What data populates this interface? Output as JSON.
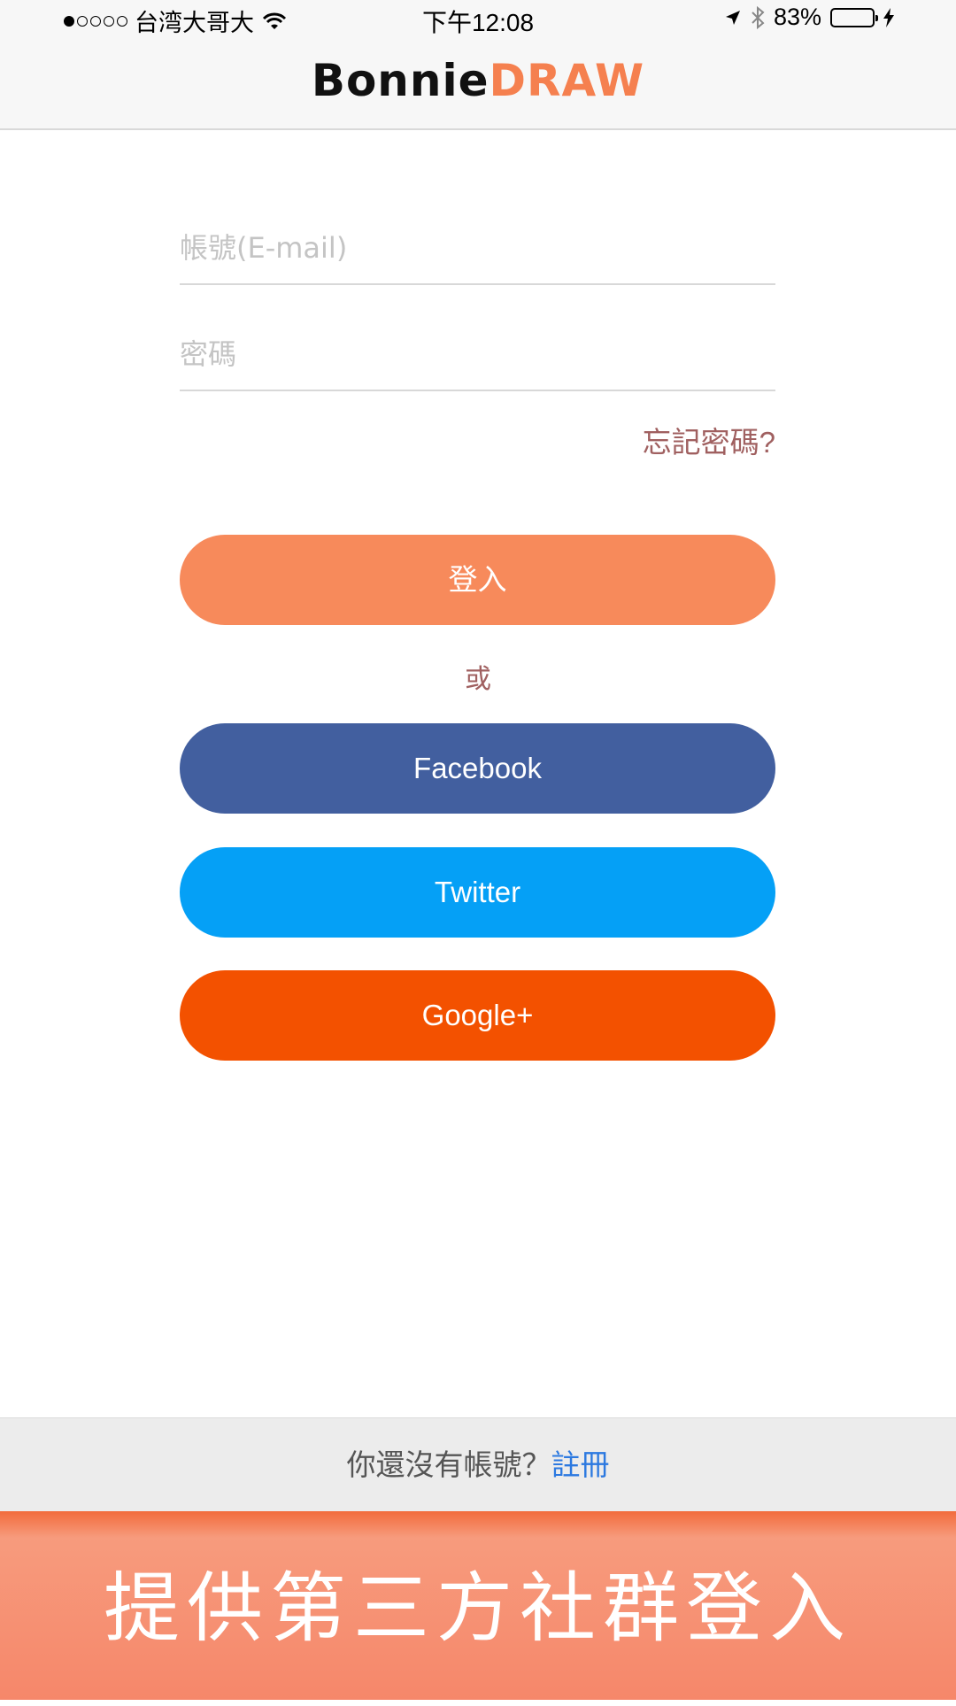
{
  "status_bar": {
    "carrier": "台湾大哥大",
    "time": "下午12:08",
    "battery": "83%",
    "battery_level": 0.83
  },
  "header": {
    "logo_part1": "Bonnie",
    "logo_part2": "DRAW",
    "colors": {
      "logo_dark": "#111111",
      "logo_accent": "#f5804f"
    }
  },
  "form": {
    "email_placeholder": "帳號(E-mail)",
    "email_value": "",
    "password_placeholder": "密碼",
    "password_value": "",
    "forgot_label": "忘記密碼?"
  },
  "buttons": {
    "login_label": "登入",
    "or_label": "或",
    "facebook_label": "Facebook",
    "twitter_label": "Twitter",
    "google_label": "Google+",
    "colors": {
      "login": "#f78a5b",
      "facebook": "#425f9f",
      "twitter": "#05a0f6",
      "google": "#f35100"
    }
  },
  "register": {
    "prompt": "你還沒有帳號？",
    "link_label": "註冊"
  },
  "banner": {
    "text": "提供第三方社群登入"
  }
}
